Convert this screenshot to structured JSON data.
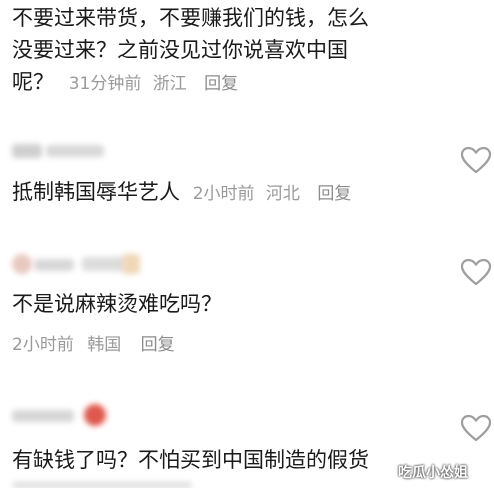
{
  "comments": [
    {
      "text_lines": [
        "不要过来带货，不要赚我们的钱，怎么",
        "没要过来？之前没见过你说喜欢中国",
        "呢？"
      ],
      "time": "31分钟前",
      "location": "浙江",
      "reply": "回复"
    },
    {
      "text": "抵制韩国辱华艺人",
      "time": "2小时前",
      "location": "河北",
      "reply": "回复"
    },
    {
      "text": "不是说麻辣烫难吃吗？",
      "time": "2小时前",
      "location": "韩国",
      "reply": "回复"
    },
    {
      "text": "有缺钱了吗？不怕买到中国制造的假货"
    }
  ],
  "icons": {
    "like": "heart-outline-icon"
  },
  "watermark": "吃瓜小怂姐",
  "colors": {
    "text": "#1a1a1a",
    "meta": "#9a9a9a",
    "heart": "#9e9e9e"
  }
}
